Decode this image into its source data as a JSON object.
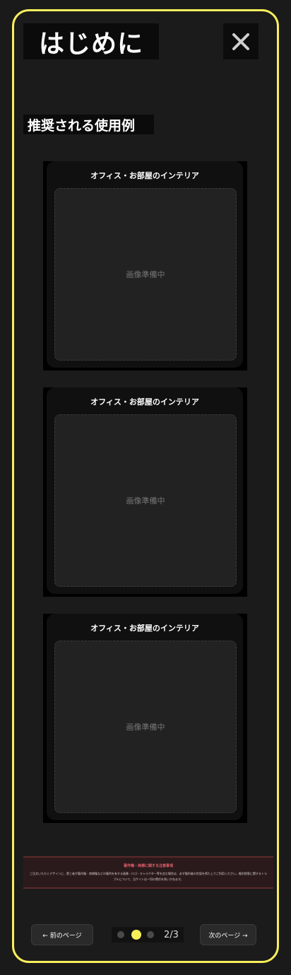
{
  "header": {
    "title": "はじめに",
    "close_icon": "close-icon"
  },
  "section": {
    "heading": "推奨される使用例"
  },
  "cards": [
    {
      "title": "オフィス・お部屋のインテリア",
      "placeholder": "画像準備中"
    },
    {
      "title": "オフィス・お部屋のインテリア",
      "placeholder": "画像準備中"
    },
    {
      "title": "オフィス・お部屋のインテリア",
      "placeholder": "画像準備中"
    }
  ],
  "notice": {
    "title": "著作権・商標に関する注意事項",
    "body": "ご注文いただくデザインに、第三者が著作権・商標権などの権利を有する画像・ロゴ・キャラクター等を含む場合は、必ず権利者の許諾を得た上でご利用ください。権利侵害に関するトラブルについて、当サイトは一切の責任を負いかねます。"
  },
  "footer": {
    "prev_label": "← 前のページ",
    "next_label": "次のページ →",
    "page_indicator": "2/3",
    "current_page": 2,
    "total_pages": 3
  },
  "colors": {
    "accent": "#f9ef5a",
    "background": "#1a1a1a",
    "notice_title": "#e0606b"
  }
}
